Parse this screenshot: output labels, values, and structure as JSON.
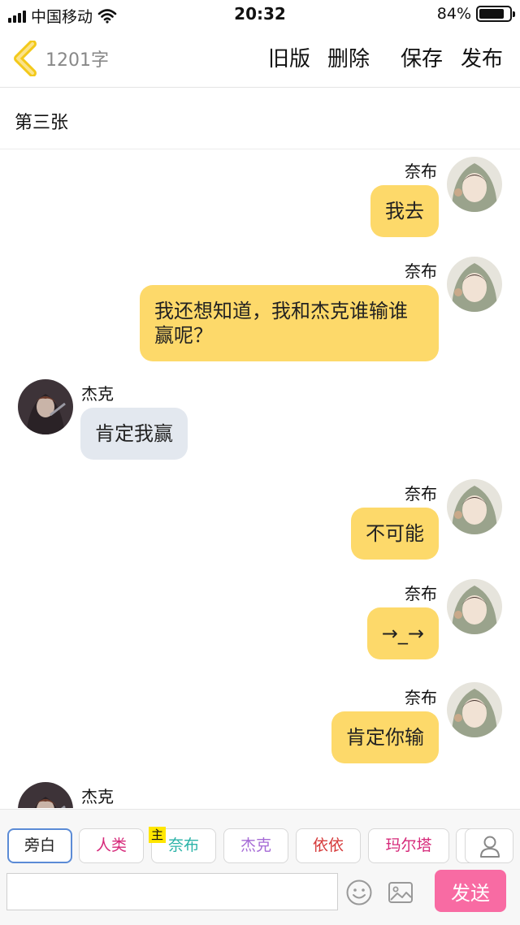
{
  "status_bar": {
    "carrier": "中国移动",
    "time": "20:32",
    "battery_percent": "84%",
    "battery_level": 0.84
  },
  "nav": {
    "word_count": "1201字",
    "old_version": "旧版",
    "delete": "删除",
    "save": "保存",
    "publish": "发布"
  },
  "title": "第三张",
  "messages": [
    {
      "side": "right",
      "sender": "奈布",
      "text": "我去"
    },
    {
      "side": "right",
      "sender": "奈布",
      "text": "我还想知道，我和杰克谁输谁赢呢？"
    },
    {
      "side": "left",
      "sender": "杰克",
      "text": "肯定我赢"
    },
    {
      "side": "right",
      "sender": "奈布",
      "text": "不可能"
    },
    {
      "side": "right",
      "sender": "奈布",
      "text": "→_→"
    },
    {
      "side": "right",
      "sender": "奈布",
      "text": "肯定你输"
    },
    {
      "side": "left",
      "sender": "杰克",
      "text": ""
    }
  ],
  "roles": [
    {
      "label": "旁白",
      "color": "#222222",
      "active": true
    },
    {
      "label": "人类",
      "color": "#d6297a"
    },
    {
      "label": "奈布",
      "color": "#2bb3a8",
      "tag": "主"
    },
    {
      "label": "杰克",
      "color": "#a66bd6"
    },
    {
      "label": "依依",
      "color": "#d63a3a"
    },
    {
      "label": "玛尔塔",
      "color": "#d6297a"
    }
  ],
  "input": {
    "value": "",
    "placeholder": ""
  },
  "send_label": "发送",
  "icons": [
    "back-chevron-icon",
    "emoji-icon",
    "image-icon",
    "person-icon"
  ],
  "colors": {
    "right_bubble": "#fdd96a",
    "left_bubble": "#e3e8ef",
    "send_button": "#f86ba3",
    "back_icon": "#f3c91b"
  }
}
